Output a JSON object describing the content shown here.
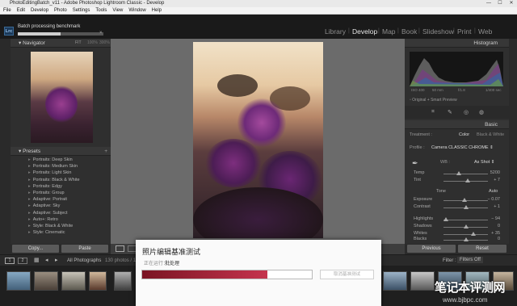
{
  "window": {
    "title": "PhotoEditingBatch_v11 - Adobe Photoshop Lightroom Classic - Develop"
  },
  "menu": [
    "File",
    "Edit",
    "Develop",
    "Photo",
    "Settings",
    "Tools",
    "View",
    "Window",
    "Help"
  ],
  "identity": {
    "logo": "Lrc",
    "task": "Batch processing benchmark",
    "task_progress": 0.5,
    "close": "×"
  },
  "modules": [
    "Library",
    "Develop",
    "Map",
    "Book",
    "Slideshow",
    "Print",
    "Web"
  ],
  "active_module": "Develop",
  "left": {
    "navigator": "Navigator",
    "nav_zoom": [
      "FIT",
      "100%",
      "300%"
    ],
    "presets_header": "Presets",
    "presets": [
      "Portraits: Deep Skin",
      "Portraits: Medium Skin",
      "Portraits: Light Skin",
      "Portraits: Black & White",
      "Portraits: Edgy",
      "Portraits: Group",
      "Adaptive: Portrait",
      "Adaptive: Sky",
      "Adaptive: Subject",
      "Auto+: Retro",
      "Style: Black & White",
      "Style: Cinematic"
    ],
    "copy": "Copy...",
    "paste": "Paste"
  },
  "right": {
    "histogram": "Histogram",
    "histo_vals": [
      "ISO 400",
      "50 mm",
      "f/1.8",
      "1/400 sec"
    ],
    "original_label": "Original + Smart Preview",
    "basic": "Basic",
    "treatment": "Treatment :",
    "color": "Color",
    "bw": "Black & White",
    "profile_label": "Profile :",
    "profile": "Camera CLASSIC CHROME ⇕",
    "wb_label": "WB :",
    "wb": "As Shot ⇕",
    "tone": "Tone",
    "auto": "Auto",
    "sliders": [
      {
        "label": "Temp",
        "value": "5200",
        "pos": 0.35
      },
      {
        "label": "Tint",
        "value": "+ 7",
        "pos": 0.55
      },
      {
        "label": "Exposure",
        "value": "− 0.07",
        "pos": 0.48
      },
      {
        "label": "Contrast",
        "value": "+ 1",
        "pos": 0.5
      },
      {
        "label": "Highlights",
        "value": "− 94",
        "pos": 0.05
      },
      {
        "label": "Shadows",
        "value": "0",
        "pos": 0.5
      },
      {
        "label": "Whites",
        "value": "+ 35",
        "pos": 0.68
      },
      {
        "label": "Blacks",
        "value": "0",
        "pos": 0.5
      }
    ],
    "previous": "Previous",
    "reset": "Reset"
  },
  "filmbar": {
    "p1": "1",
    "p2": "2",
    "source": "All Photographs",
    "count": "130 photos / 1 selected",
    "filter_label": "Filter :",
    "filter": "Filters Off"
  },
  "dialog": {
    "title": "照片编辑基准测试",
    "status_label": "正在运行：",
    "status_value": "批处理",
    "progress": 0.74,
    "cancel": "取消基准测试"
  },
  "watermark": {
    "text": "笔记本评测网",
    "url": "www.bjbpc.com"
  }
}
